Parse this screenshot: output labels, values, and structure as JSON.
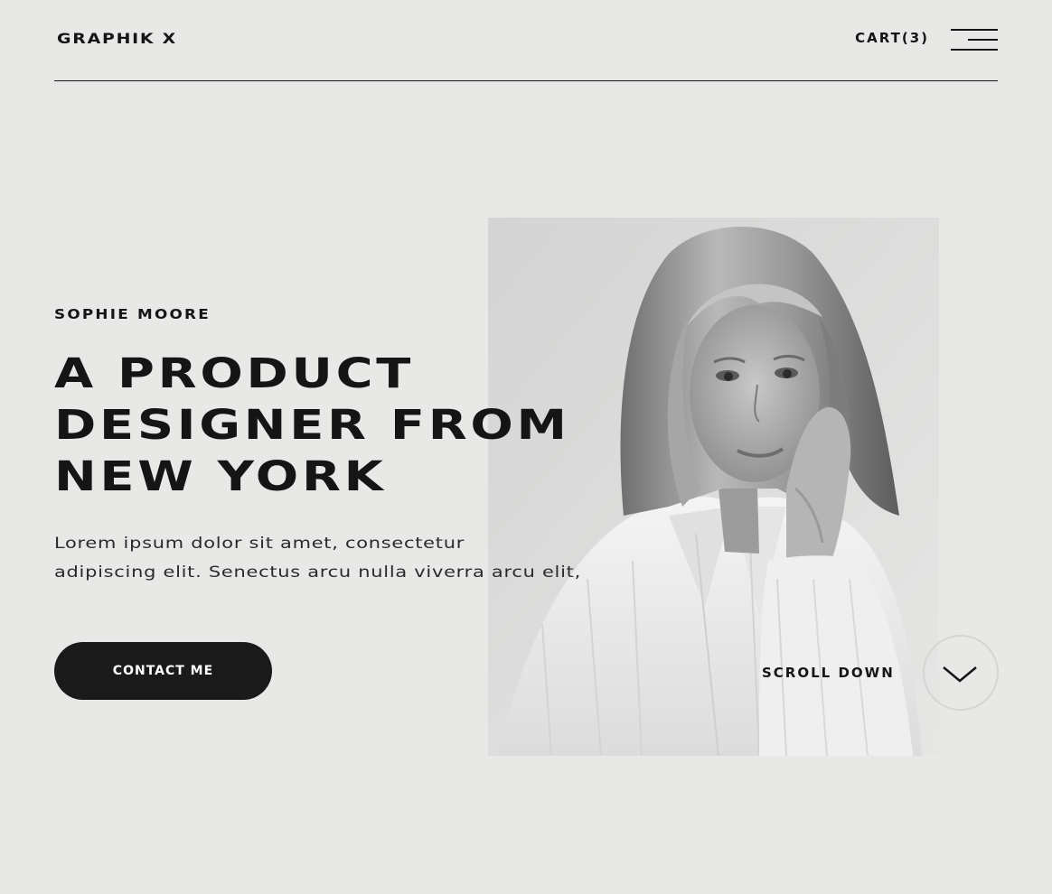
{
  "header": {
    "logo": "GRAPHIK X",
    "cart_label": "CART(3)",
    "menu_icon": "hamburger-menu-icon"
  },
  "hero": {
    "eyebrow": "SOPHIE MOORE",
    "headline_lines": [
      "A PRODUCT",
      "DESIGNER FROM",
      "NEW YORK"
    ],
    "body_lines": [
      "Lorem ipsum dolor sit amet, consectetur",
      "adipiscing elit. Senectus arcu nulla viverra arcu elit,"
    ],
    "cta_label": "CONTACT ME",
    "scroll_label": "SCROLL DOWN",
    "scroll_icon": "chevron-down-icon",
    "portrait": "black-and-white portrait photo"
  },
  "colors": {
    "background": "#e8e9e6",
    "text": "#151515",
    "button": "#1a1a1a",
    "button_text": "#ffffff",
    "circle_border": "#d5d6d3"
  }
}
